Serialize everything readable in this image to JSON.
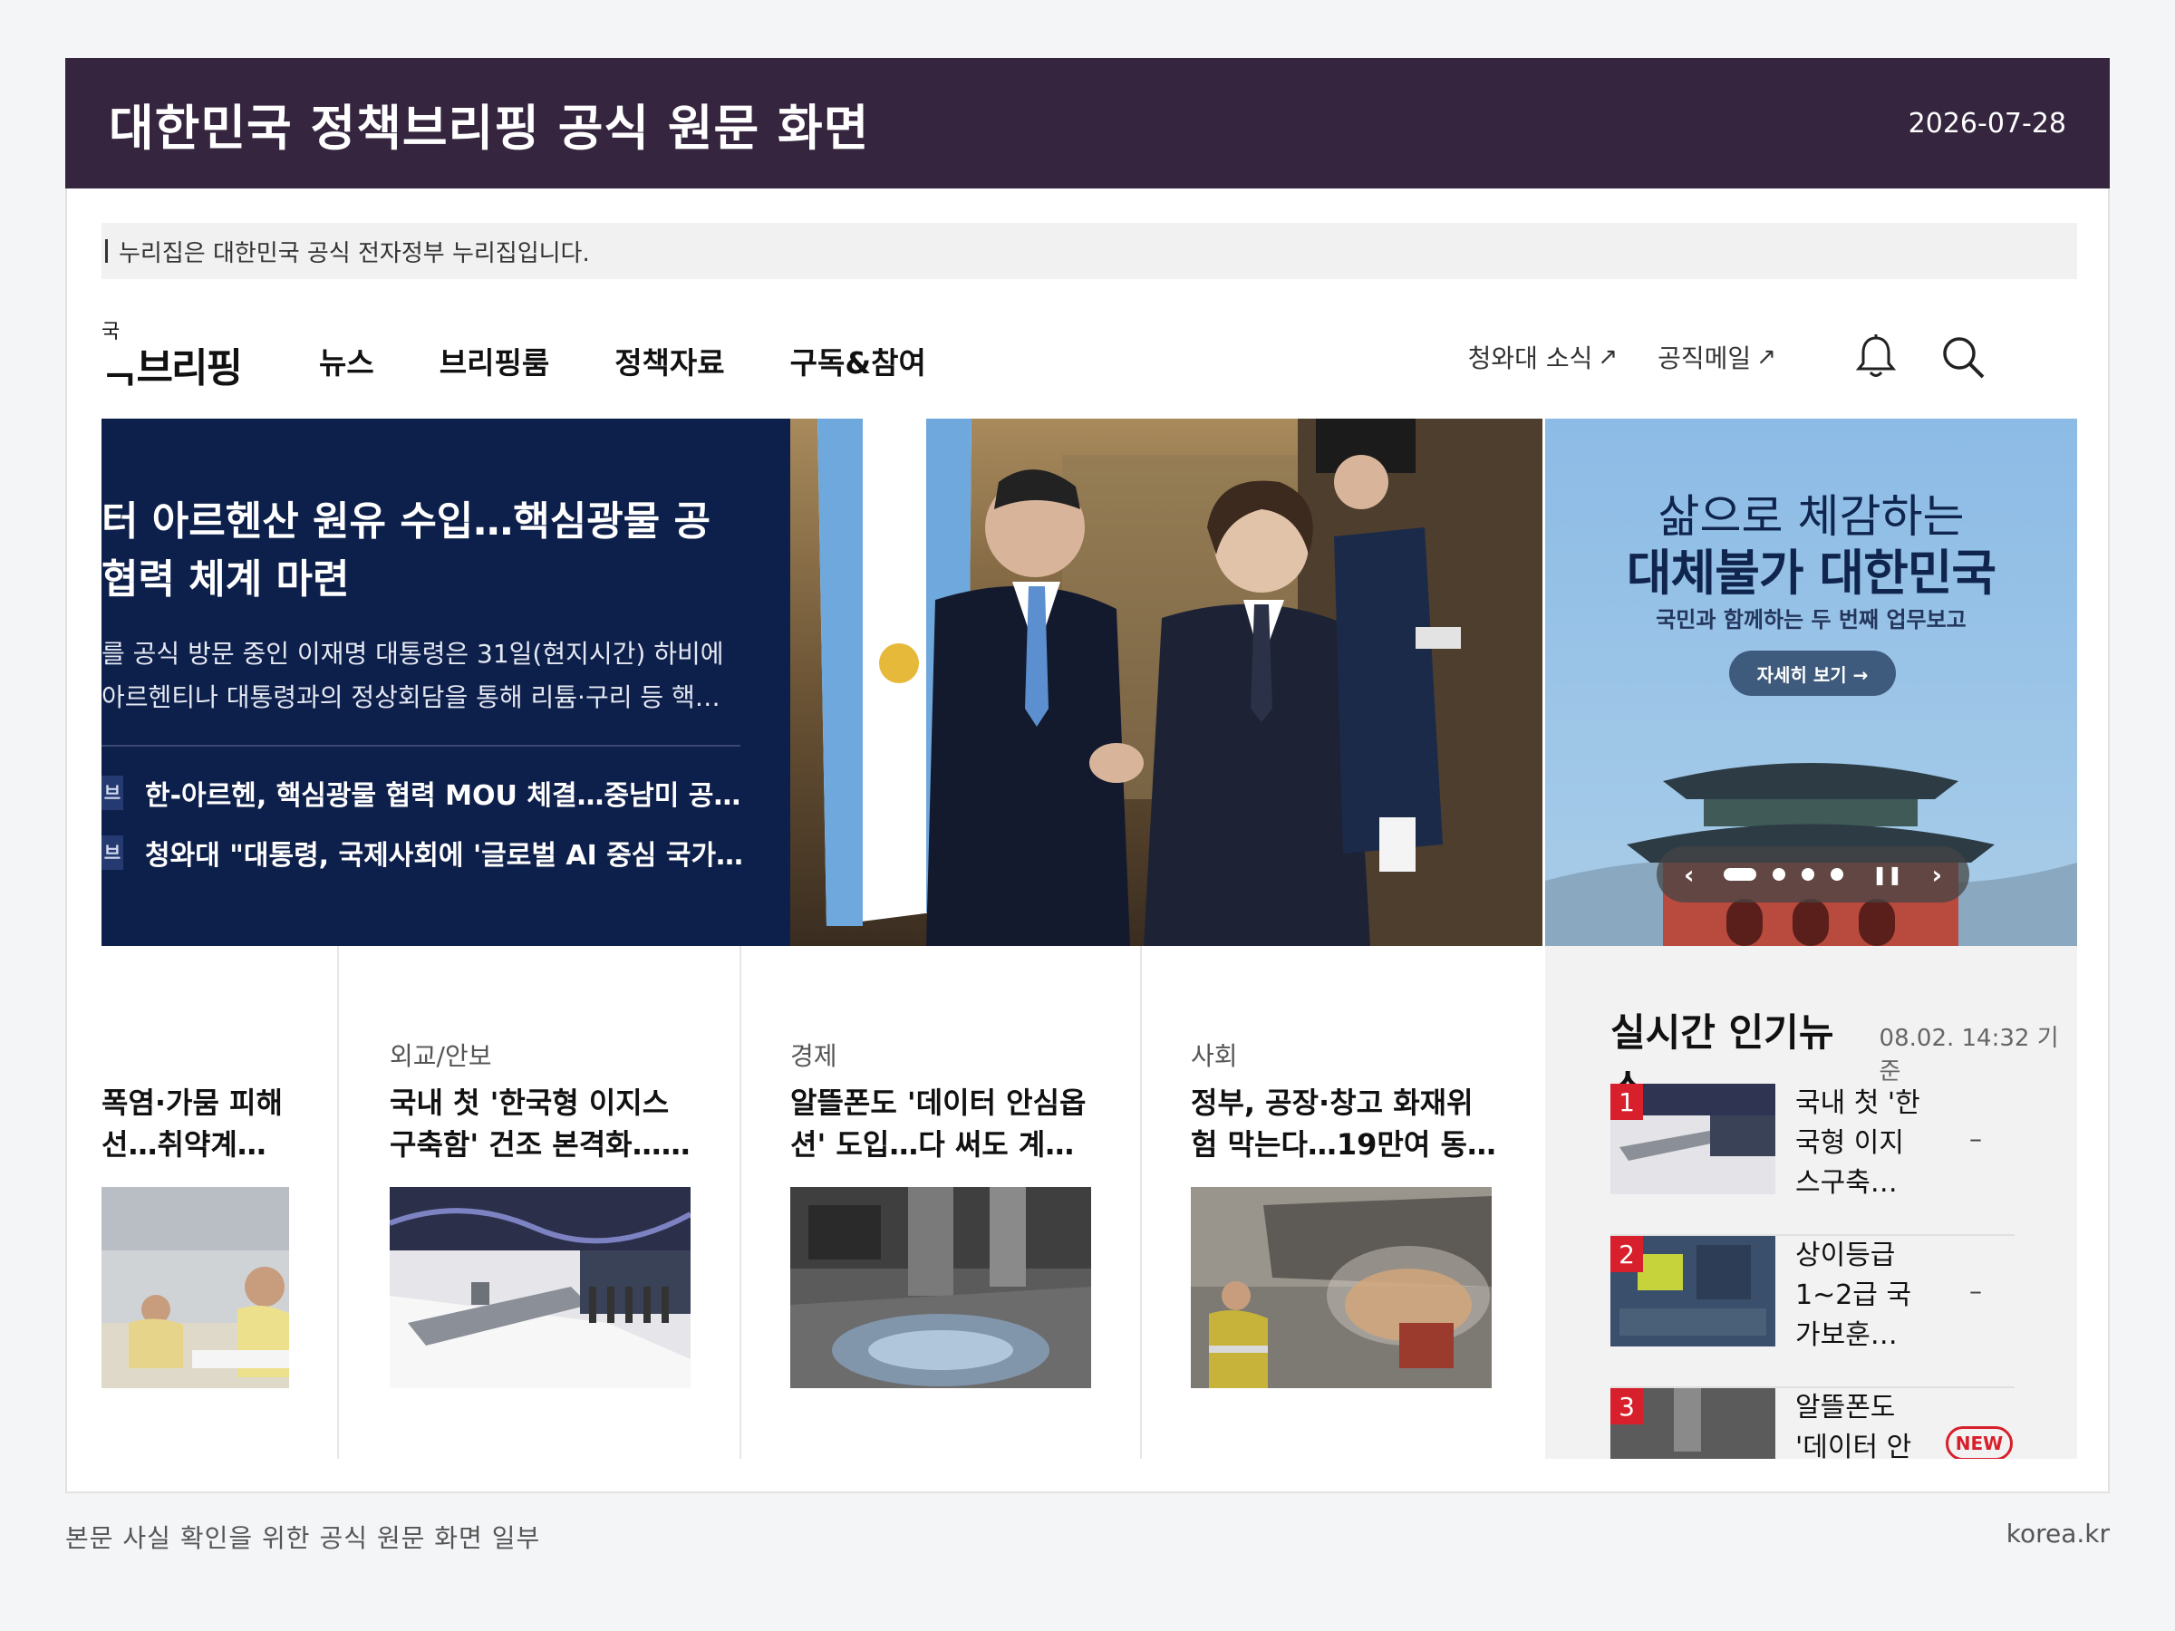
{
  "header": {
    "title": "대한민국 정책브리핑 공식 원문 화면",
    "date": "2026-07-28"
  },
  "gov_notice": "누리집은 대한민국 공식 전자정부 누리집입니다.",
  "site": {
    "logo_small": "국",
    "logo_text": "ᆨ브리핑",
    "menu": [
      "뉴스",
      "브리핑룸",
      "정책자료",
      "구독&참여"
    ],
    "external_links": [
      "청와대 소식",
      "공직메일"
    ],
    "icons": [
      "bell-icon",
      "search-icon"
    ]
  },
  "hero": {
    "headline_1": "터 아르헨산 원유 수입…핵심광물 공",
    "headline_2": "협력 체계 마련",
    "summary_1": "를 공식 방문 중인 이재명 대통령은 31일(현지시간) 하비에",
    "summary_2": "아르헨티나 대통령과의 정상회담을 통해 리튬·구리 등 핵…",
    "related": [
      {
        "tag": "브",
        "text": "한-아르헨, 핵심광물 협력 MOU 체결…중남미 공…"
      },
      {
        "tag": "브",
        "text": "청와대 \"대통령, 국제사회에 '글로벌 AI 중심 국가…"
      }
    ]
  },
  "banner": {
    "line1": "삶으로 체감하는",
    "line2": "대체불가 대한민국",
    "line3": "국민과 함께하는 두 번째 업무보고",
    "button": "자세히 보기 →",
    "prev": "‹",
    "next": "›",
    "pause": "❚❚"
  },
  "cards": [
    {
      "category": "",
      "title_1": "폭염·가뭄 피해",
      "title_2": "선…취약계…"
    },
    {
      "category": "외교/안보",
      "title_1": "국내 첫 '한국형 이지스",
      "title_2": "구축함' 건조 본격화……"
    },
    {
      "category": "경제",
      "title_1": "알뜰폰도 '데이터 안심옵",
      "title_2": "션' 도입…다 써도 계…"
    },
    {
      "category": "사회",
      "title_1": "정부, 공장·창고 화재위",
      "title_2": "험 막는다…19만여 동…"
    }
  ],
  "popular": {
    "title": "실시간 인기뉴스",
    "timestamp": "08.02. 14:32 기준",
    "items": [
      {
        "rank": "1",
        "lines": [
          "국내 첫 '한",
          "국형 이지",
          "스구축…"
        ],
        "trend": "–"
      },
      {
        "rank": "2",
        "lines": [
          "상이등급",
          "1~2급 국",
          "가보훈…"
        ],
        "trend": "–"
      },
      {
        "rank": "3",
        "lines": [
          "알뜰폰도",
          "'데이터 안",
          ""
        ],
        "badge": "NEW"
      }
    ]
  },
  "footer": {
    "caption": "본문 사실 확인을 위한 공식 원문 화면 일부",
    "source": "korea.kr"
  }
}
